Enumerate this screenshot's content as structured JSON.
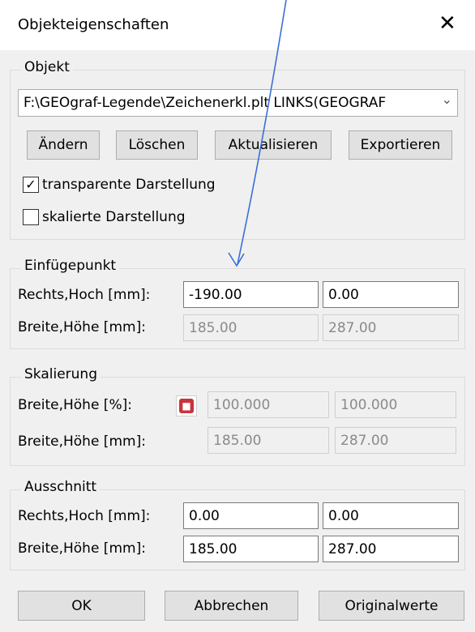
{
  "window": {
    "title": "Objekteigenschaften",
    "close_symbol": "✕"
  },
  "objekt": {
    "legend": "Objekt",
    "file_value": "F:\\GEOgraf-Legende\\Zeichenerkl.plt LINKS(GEOGRAF",
    "buttons": {
      "change": "Ändern",
      "delete": "Löschen",
      "refresh": "Aktualisieren",
      "export": "Exportieren"
    },
    "transparent": {
      "label": "transparente Darstellung",
      "checked": true
    },
    "scaled": {
      "label": "skalierte Darstellung",
      "checked": false
    }
  },
  "einfuegepunkt": {
    "legend": "Einfügepunkt",
    "row1_label": "Rechts,Hoch [mm]:",
    "row1_value1": "-190.00",
    "row1_value2": "0.00",
    "row2_label": "Breite,Höhe [mm]:",
    "row2_value1": "185.00",
    "row2_value2": "287.00"
  },
  "skalierung": {
    "legend": "Skalierung",
    "row1_label": "Breite,Höhe [%]:",
    "row1_value1": "100.000",
    "row1_value2": "100.000",
    "row2_label": "Breite,Höhe [mm]:",
    "row2_value1": "185.00",
    "row2_value2": "287.00",
    "lock_icon": "lock-icon"
  },
  "ausschnitt": {
    "legend": "Ausschnitt",
    "row1_label": "Rechts,Hoch [mm]:",
    "row1_value1": "0.00",
    "row1_value2": "0.00",
    "row2_label": "Breite,Höhe [mm]:",
    "row2_value1": "185.00",
    "row2_value2": "287.00"
  },
  "footer": {
    "ok": "OK",
    "cancel": "Abbrechen",
    "original": "Originalwerte"
  },
  "colors": {
    "annotation_arrow": "#3a6fd8",
    "lock": "#c9333b"
  }
}
